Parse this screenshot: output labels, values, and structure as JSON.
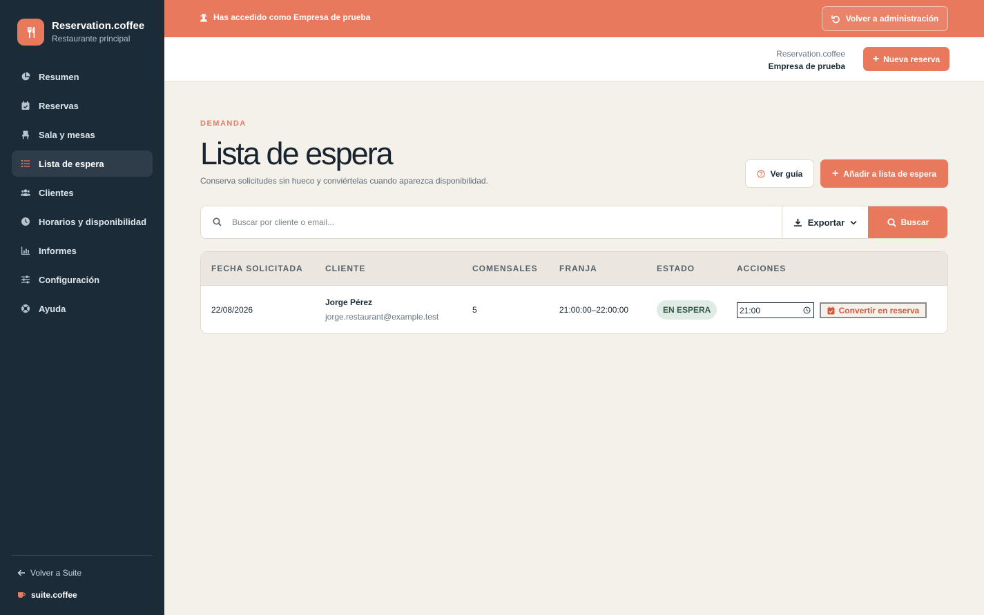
{
  "brand": {
    "name": "Reservation.coffee",
    "subtitle": "Restaurante principal"
  },
  "sidebar": {
    "items": [
      {
        "label": "Resumen",
        "icon": "pie-chart-icon",
        "active": false
      },
      {
        "label": "Reservas",
        "icon": "calendar-check-icon",
        "active": false
      },
      {
        "label": "Sala y mesas",
        "icon": "chair-icon",
        "active": false
      },
      {
        "label": "Lista de espera",
        "icon": "list-icon",
        "active": true
      },
      {
        "label": "Clientes",
        "icon": "users-icon",
        "active": false
      },
      {
        "label": "Horarios y disponibilidad",
        "icon": "clock-icon",
        "active": false
      },
      {
        "label": "Informes",
        "icon": "bar-chart-icon",
        "active": false
      },
      {
        "label": "Configuración",
        "icon": "sliders-icon",
        "active": false
      },
      {
        "label": "Ayuda",
        "icon": "lifebuoy-icon",
        "active": false
      }
    ],
    "back_label": "Volver a Suite",
    "suite_label": "suite.coffee"
  },
  "banner": {
    "text": "Has accedido como Empresa de prueba",
    "back_admin_label": "Volver a administración"
  },
  "header": {
    "org_line1": "Reservation.coffee",
    "org_line2": "Empresa de prueba",
    "new_reservation_label": "Nueva reserva"
  },
  "page": {
    "eyebrow": "DEMANDA",
    "title": "Lista de espera",
    "subtitle": "Conserva solicitudes sin hueco y conviértelas cuando aparezca disponibilidad.",
    "guide_label": "Ver guía",
    "add_label": "Añadir a lista de espera"
  },
  "search": {
    "placeholder": "Buscar por cliente o email...",
    "export_label": "Exportar",
    "search_label": "Buscar"
  },
  "table": {
    "headers": [
      "FECHA SOLICITADA",
      "CLIENTE",
      "COMENSALES",
      "FRANJA",
      "ESTADO",
      "ACCIONES"
    ],
    "rows": [
      {
        "date": "22/08/2026",
        "client_name": "Jorge Pérez",
        "client_email": "jorge.restaurant@example.test",
        "guests": "5",
        "slot": "21:00:00–22:00:00",
        "status": "EN ESPERA",
        "time_value": "21:00",
        "convert_label": "Convertir en reserva"
      }
    ]
  },
  "colors": {
    "accent": "#e8795d",
    "sidebar_bg": "#1b2b38",
    "page_bg": "#f4f0ea",
    "status_bg": "#e0ebe5",
    "status_text": "#2f5a48"
  }
}
